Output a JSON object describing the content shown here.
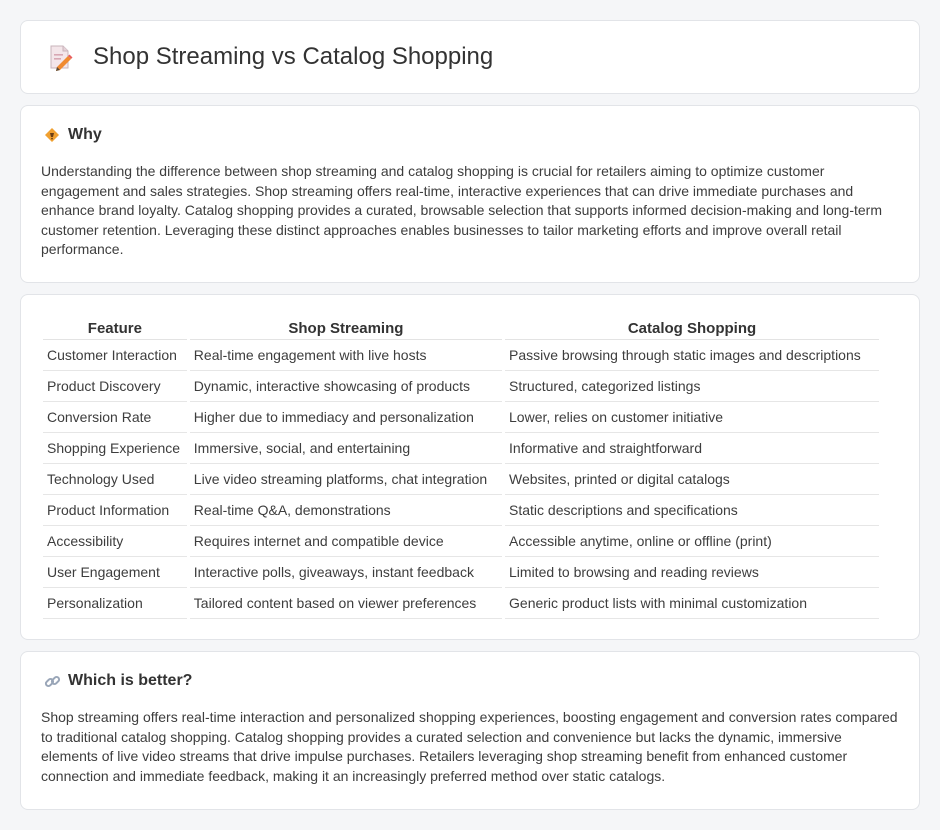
{
  "header": {
    "title": "Shop Streaming vs Catalog Shopping",
    "icon": "document-pencil-icon"
  },
  "why": {
    "title": "Why",
    "icon": "diamond-sign-icon",
    "text": "Understanding the difference between shop streaming and catalog shopping is crucial for retailers aiming to optimize customer engagement and sales strategies. Shop streaming offers real-time, interactive experiences that can drive immediate purchases and enhance brand loyalty. Catalog shopping provides a curated, browsable selection that supports informed decision-making and long-term customer retention. Leveraging these distinct approaches enables businesses to tailor marketing efforts and improve overall retail performance."
  },
  "comparison": {
    "headers": [
      "Feature",
      "Shop Streaming",
      "Catalog Shopping"
    ],
    "rows": [
      [
        "Customer Interaction",
        "Real-time engagement with live hosts",
        "Passive browsing through static images and descriptions"
      ],
      [
        "Product Discovery",
        "Dynamic, interactive showcasing of products",
        "Structured, categorized listings"
      ],
      [
        "Conversion Rate",
        "Higher due to immediacy and personalization",
        "Lower, relies on customer initiative"
      ],
      [
        "Shopping Experience",
        "Immersive, social, and entertaining",
        "Informative and straightforward"
      ],
      [
        "Technology Used",
        "Live video streaming platforms, chat integration",
        "Websites, printed or digital catalogs"
      ],
      [
        "Product Information",
        "Real-time Q&A, demonstrations",
        "Static descriptions and specifications"
      ],
      [
        "Accessibility",
        "Requires internet and compatible device",
        "Accessible anytime, online or offline (print)"
      ],
      [
        "User Engagement",
        "Interactive polls, giveaways, instant feedback",
        "Limited to browsing and reading reviews"
      ],
      [
        "Personalization",
        "Tailored content based on viewer preferences",
        "Generic product lists with minimal customization"
      ]
    ]
  },
  "better": {
    "title": "Which is better?",
    "icon": "link-icon",
    "text": "Shop streaming offers real-time interaction and personalized shopping experiences, boosting engagement and conversion rates compared to traditional catalog shopping. Catalog shopping provides a curated selection and convenience but lacks the dynamic, immersive elements of live video streams that drive impulse purchases. Retailers leveraging shop streaming benefit from enhanced customer connection and immediate feedback, making it an increasingly preferred method over static catalogs."
  },
  "colors": {
    "background": "#f5f6f8",
    "card": "#ffffff",
    "border": "#e2e4e8",
    "accent_orange": "#f0a030"
  }
}
